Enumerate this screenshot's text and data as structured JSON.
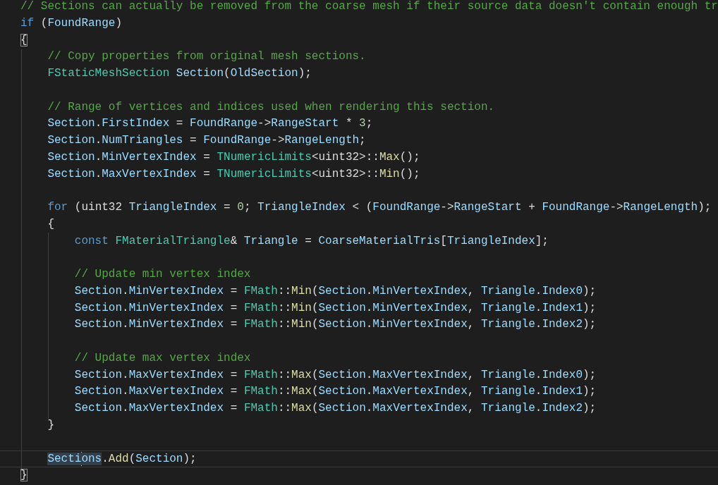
{
  "editor": {
    "lines": [
      {
        "kind": "code",
        "tokens": [
          {
            "kind": "c",
            "text": "// Sections can actually be removed from the coarse mesh if their source data doesn't contain enough tr"
          }
        ]
      },
      {
        "kind": "code",
        "tokens": [
          {
            "kind": "k",
            "text": "if"
          },
          {
            "kind": "p",
            "text": " ("
          },
          {
            "kind": "v",
            "text": "FoundRange"
          },
          {
            "kind": "p",
            "text": ")"
          }
        ]
      },
      {
        "kind": "code",
        "tokens": [
          {
            "kind": "bm",
            "text": "{"
          }
        ]
      },
      {
        "kind": "code",
        "tokens": [
          {
            "kind": "c",
            "text": "    // Copy properties from original mesh sections."
          }
        ]
      },
      {
        "kind": "code",
        "tokens": [
          {
            "kind": "t",
            "text": "    FStaticMeshSection"
          },
          {
            "kind": "v",
            "text": " Section"
          },
          {
            "kind": "p",
            "text": "("
          },
          {
            "kind": "v",
            "text": "OldSection"
          },
          {
            "kind": "p",
            "text": ");"
          }
        ]
      },
      {
        "kind": "blank"
      },
      {
        "kind": "code",
        "tokens": [
          {
            "kind": "c",
            "text": "    // Range of vertices and indices used when rendering this section."
          }
        ]
      },
      {
        "kind": "code",
        "tokens": [
          {
            "kind": "v",
            "text": "    Section"
          },
          {
            "kind": "p",
            "text": "."
          },
          {
            "kind": "v",
            "text": "FirstIndex"
          },
          {
            "kind": "p",
            "text": " = "
          },
          {
            "kind": "v",
            "text": "FoundRange"
          },
          {
            "kind": "p",
            "text": "->"
          },
          {
            "kind": "v",
            "text": "RangeStart"
          },
          {
            "kind": "p",
            "text": " * "
          },
          {
            "kind": "n",
            "text": "3"
          },
          {
            "kind": "p",
            "text": ";"
          }
        ]
      },
      {
        "kind": "code",
        "tokens": [
          {
            "kind": "v",
            "text": "    Section"
          },
          {
            "kind": "p",
            "text": "."
          },
          {
            "kind": "v",
            "text": "NumTriangles"
          },
          {
            "kind": "p",
            "text": " = "
          },
          {
            "kind": "v",
            "text": "FoundRange"
          },
          {
            "kind": "p",
            "text": "->"
          },
          {
            "kind": "v",
            "text": "RangeLength"
          },
          {
            "kind": "p",
            "text": ";"
          }
        ]
      },
      {
        "kind": "code",
        "tokens": [
          {
            "kind": "v",
            "text": "    Section"
          },
          {
            "kind": "p",
            "text": "."
          },
          {
            "kind": "v",
            "text": "MinVertexIndex"
          },
          {
            "kind": "p",
            "text": " = "
          },
          {
            "kind": "t",
            "text": "TNumericLimits"
          },
          {
            "kind": "p",
            "text": "<uint32>::"
          },
          {
            "kind": "f",
            "text": "Max"
          },
          {
            "kind": "p",
            "text": "();"
          }
        ]
      },
      {
        "kind": "code",
        "tokens": [
          {
            "kind": "v",
            "text": "    Section"
          },
          {
            "kind": "p",
            "text": "."
          },
          {
            "kind": "v",
            "text": "MaxVertexIndex"
          },
          {
            "kind": "p",
            "text": " = "
          },
          {
            "kind": "t",
            "text": "TNumericLimits"
          },
          {
            "kind": "p",
            "text": "<uint32>::"
          },
          {
            "kind": "f",
            "text": "Min"
          },
          {
            "kind": "p",
            "text": "();"
          }
        ]
      },
      {
        "kind": "blank"
      },
      {
        "kind": "code",
        "tokens": [
          {
            "kind": "k",
            "text": "    for"
          },
          {
            "kind": "p",
            "text": " (uint32 "
          },
          {
            "kind": "v",
            "text": "TriangleIndex"
          },
          {
            "kind": "p",
            "text": " = "
          },
          {
            "kind": "n",
            "text": "0"
          },
          {
            "kind": "p",
            "text": "; "
          },
          {
            "kind": "v",
            "text": "TriangleIndex"
          },
          {
            "kind": "p",
            "text": " < ("
          },
          {
            "kind": "v",
            "text": "FoundRange"
          },
          {
            "kind": "p",
            "text": "->"
          },
          {
            "kind": "v",
            "text": "RangeStart"
          },
          {
            "kind": "p",
            "text": " + "
          },
          {
            "kind": "v",
            "text": "FoundRange"
          },
          {
            "kind": "p",
            "text": "->"
          },
          {
            "kind": "v",
            "text": "RangeLength"
          },
          {
            "kind": "p",
            "text": ");"
          }
        ]
      },
      {
        "kind": "code",
        "tokens": [
          {
            "kind": "p",
            "text": "    {"
          }
        ]
      },
      {
        "kind": "code",
        "tokens": [
          {
            "kind": "k",
            "text": "        const"
          },
          {
            "kind": "t",
            "text": " FMaterialTriangle"
          },
          {
            "kind": "p",
            "text": "& "
          },
          {
            "kind": "v",
            "text": "Triangle"
          },
          {
            "kind": "p",
            "text": " = "
          },
          {
            "kind": "v",
            "text": "CoarseMaterialTris"
          },
          {
            "kind": "p",
            "text": "["
          },
          {
            "kind": "v",
            "text": "TriangleIndex"
          },
          {
            "kind": "p",
            "text": "];"
          }
        ]
      },
      {
        "kind": "blank"
      },
      {
        "kind": "code",
        "tokens": [
          {
            "kind": "c",
            "text": "        // Update min vertex index"
          }
        ]
      },
      {
        "kind": "code",
        "tokens": [
          {
            "kind": "v",
            "text": "        Section"
          },
          {
            "kind": "p",
            "text": "."
          },
          {
            "kind": "v",
            "text": "MinVertexIndex"
          },
          {
            "kind": "p",
            "text": " = "
          },
          {
            "kind": "t",
            "text": "FMath"
          },
          {
            "kind": "p",
            "text": "::"
          },
          {
            "kind": "f",
            "text": "Min"
          },
          {
            "kind": "p",
            "text": "("
          },
          {
            "kind": "v",
            "text": "Section"
          },
          {
            "kind": "p",
            "text": "."
          },
          {
            "kind": "v",
            "text": "MinVertexIndex"
          },
          {
            "kind": "p",
            "text": ", "
          },
          {
            "kind": "v",
            "text": "Triangle"
          },
          {
            "kind": "p",
            "text": "."
          },
          {
            "kind": "v",
            "text": "Index0"
          },
          {
            "kind": "p",
            "text": ");"
          }
        ]
      },
      {
        "kind": "code",
        "tokens": [
          {
            "kind": "v",
            "text": "        Section"
          },
          {
            "kind": "p",
            "text": "."
          },
          {
            "kind": "v",
            "text": "MinVertexIndex"
          },
          {
            "kind": "p",
            "text": " = "
          },
          {
            "kind": "t",
            "text": "FMath"
          },
          {
            "kind": "p",
            "text": "::"
          },
          {
            "kind": "f",
            "text": "Min"
          },
          {
            "kind": "p",
            "text": "("
          },
          {
            "kind": "v",
            "text": "Section"
          },
          {
            "kind": "p",
            "text": "."
          },
          {
            "kind": "v",
            "text": "MinVertexIndex"
          },
          {
            "kind": "p",
            "text": ", "
          },
          {
            "kind": "v",
            "text": "Triangle"
          },
          {
            "kind": "p",
            "text": "."
          },
          {
            "kind": "v",
            "text": "Index1"
          },
          {
            "kind": "p",
            "text": ");"
          }
        ]
      },
      {
        "kind": "code",
        "tokens": [
          {
            "kind": "v",
            "text": "        Section"
          },
          {
            "kind": "p",
            "text": "."
          },
          {
            "kind": "v",
            "text": "MinVertexIndex"
          },
          {
            "kind": "p",
            "text": " = "
          },
          {
            "kind": "t",
            "text": "FMath"
          },
          {
            "kind": "p",
            "text": "::"
          },
          {
            "kind": "f",
            "text": "Min"
          },
          {
            "kind": "p",
            "text": "("
          },
          {
            "kind": "v",
            "text": "Section"
          },
          {
            "kind": "p",
            "text": "."
          },
          {
            "kind": "v",
            "text": "MinVertexIndex"
          },
          {
            "kind": "p",
            "text": ", "
          },
          {
            "kind": "v",
            "text": "Triangle"
          },
          {
            "kind": "p",
            "text": "."
          },
          {
            "kind": "v",
            "text": "Index2"
          },
          {
            "kind": "p",
            "text": ");"
          }
        ]
      },
      {
        "kind": "blank"
      },
      {
        "kind": "code",
        "tokens": [
          {
            "kind": "c",
            "text": "        // Update max vertex index"
          }
        ]
      },
      {
        "kind": "code",
        "tokens": [
          {
            "kind": "v",
            "text": "        Section"
          },
          {
            "kind": "p",
            "text": "."
          },
          {
            "kind": "v",
            "text": "MaxVertexIndex"
          },
          {
            "kind": "p",
            "text": " = "
          },
          {
            "kind": "t",
            "text": "FMath"
          },
          {
            "kind": "p",
            "text": "::"
          },
          {
            "kind": "f",
            "text": "Max"
          },
          {
            "kind": "p",
            "text": "("
          },
          {
            "kind": "v",
            "text": "Section"
          },
          {
            "kind": "p",
            "text": "."
          },
          {
            "kind": "v",
            "text": "MaxVertexIndex"
          },
          {
            "kind": "p",
            "text": ", "
          },
          {
            "kind": "v",
            "text": "Triangle"
          },
          {
            "kind": "p",
            "text": "."
          },
          {
            "kind": "v",
            "text": "Index0"
          },
          {
            "kind": "p",
            "text": ");"
          }
        ]
      },
      {
        "kind": "code",
        "tokens": [
          {
            "kind": "v",
            "text": "        Section"
          },
          {
            "kind": "p",
            "text": "."
          },
          {
            "kind": "v",
            "text": "MaxVertexIndex"
          },
          {
            "kind": "p",
            "text": " = "
          },
          {
            "kind": "t",
            "text": "FMath"
          },
          {
            "kind": "p",
            "text": "::"
          },
          {
            "kind": "f",
            "text": "Max"
          },
          {
            "kind": "p",
            "text": "("
          },
          {
            "kind": "v",
            "text": "Section"
          },
          {
            "kind": "p",
            "text": "."
          },
          {
            "kind": "v",
            "text": "MaxVertexIndex"
          },
          {
            "kind": "p",
            "text": ", "
          },
          {
            "kind": "v",
            "text": "Triangle"
          },
          {
            "kind": "p",
            "text": "."
          },
          {
            "kind": "v",
            "text": "Index1"
          },
          {
            "kind": "p",
            "text": ");"
          }
        ]
      },
      {
        "kind": "code",
        "tokens": [
          {
            "kind": "v",
            "text": "        Section"
          },
          {
            "kind": "p",
            "text": "."
          },
          {
            "kind": "v",
            "text": "MaxVertexIndex"
          },
          {
            "kind": "p",
            "text": " = "
          },
          {
            "kind": "t",
            "text": "FMath"
          },
          {
            "kind": "p",
            "text": "::"
          },
          {
            "kind": "f",
            "text": "Max"
          },
          {
            "kind": "p",
            "text": "("
          },
          {
            "kind": "v",
            "text": "Section"
          },
          {
            "kind": "p",
            "text": "."
          },
          {
            "kind": "v",
            "text": "MaxVertexIndex"
          },
          {
            "kind": "p",
            "text": ", "
          },
          {
            "kind": "v",
            "text": "Triangle"
          },
          {
            "kind": "p",
            "text": "."
          },
          {
            "kind": "v",
            "text": "Index2"
          },
          {
            "kind": "p",
            "text": ");"
          }
        ]
      },
      {
        "kind": "code",
        "tokens": [
          {
            "kind": "p",
            "text": "    }"
          }
        ]
      },
      {
        "kind": "blank"
      },
      {
        "kind": "current",
        "tokens": [
          {
            "kind": "hl",
            "text": "Secti"
          },
          {
            "kind": "caret"
          },
          {
            "kind": "hl",
            "text": "ons"
          },
          {
            "kind": "p",
            "text": "."
          },
          {
            "kind": "f",
            "text": "Add"
          },
          {
            "kind": "p",
            "text": "("
          },
          {
            "kind": "v",
            "text": "Section"
          },
          {
            "kind": "p",
            "text": ");"
          }
        ]
      },
      {
        "kind": "code",
        "tokens": [
          {
            "kind": "bm",
            "text": "}"
          }
        ]
      }
    ]
  }
}
